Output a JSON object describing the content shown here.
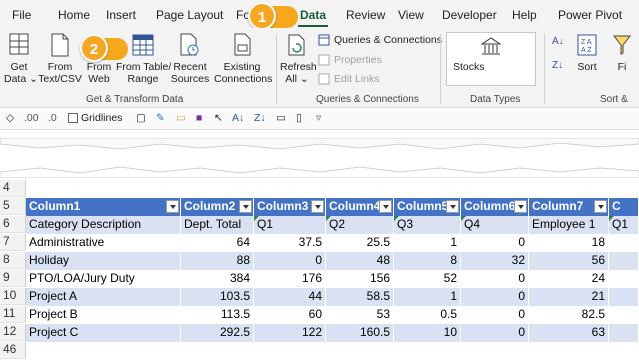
{
  "ribbon_tabs": [
    "File",
    "Home",
    "Insert",
    "Page Layout",
    "Fo",
    "Data",
    "Review",
    "View",
    "Developer",
    "Help",
    "Power Pivot"
  ],
  "active_tab": "Data",
  "callouts": {
    "one": "1",
    "two": "2"
  },
  "groups": {
    "get_transform": {
      "label": "Get & Transform Data",
      "buttons": {
        "get_data": "Get\nData ⌄",
        "text_csv": "From\nText/CSV",
        "web": "From\nWeb",
        "table_range": "From Table/\nRange",
        "recent": "Recent\nSources",
        "existing": "Existing\nConnections"
      }
    },
    "queries": {
      "label": "Queries & Connections",
      "refresh": "Refresh\nAll ⌄",
      "queries_connections": "Queries & Connections",
      "properties": "Properties",
      "edit_links": "Edit Links"
    },
    "data_types": {
      "label": "Data Types",
      "stocks": "Stocks"
    },
    "sort_filter": {
      "label": "Sort &",
      "sort": "Sort",
      "filter": "Fi"
    }
  },
  "qat": {
    "gridlines_label": "Gridlines"
  },
  "sheet": {
    "row_numbers": [
      "4",
      "5",
      "6",
      "7",
      "8",
      "9",
      "10",
      "11",
      "12",
      "46"
    ],
    "headers": [
      "Column1",
      "Column2",
      "Column3",
      "Column4",
      "Column5",
      "Column6",
      "Column7",
      "C"
    ],
    "rows": [
      [
        "Category Description",
        "Dept. Total",
        "Q1",
        "Q2",
        "Q3",
        "Q4",
        "Employee 1",
        "Q1"
      ],
      [
        "Administrative",
        "64",
        "37.5",
        "25.5",
        "1",
        "0",
        "18",
        ""
      ],
      [
        "Holiday",
        "88",
        "0",
        "48",
        "8",
        "32",
        "56",
        ""
      ],
      [
        "PTO/LOA/Jury Duty",
        "384",
        "176",
        "156",
        "52",
        "0",
        "24",
        ""
      ],
      [
        "Project A",
        "103.5",
        "44",
        "58.5",
        "1",
        "0",
        "21",
        ""
      ],
      [
        "Project B",
        "113.5",
        "60",
        "53",
        "0.5",
        "0",
        "82.5",
        ""
      ],
      [
        "Project C",
        "292.5",
        "122",
        "160.5",
        "10",
        "0",
        "63",
        ""
      ]
    ]
  },
  "colors": {
    "table_header": "#4472c4",
    "band": "#d9e1f2",
    "callout": "#f5a623",
    "active_tab": "#185c37"
  }
}
